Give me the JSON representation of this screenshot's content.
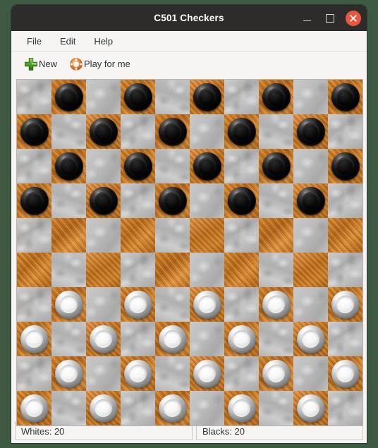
{
  "window": {
    "title": "C501 Checkers",
    "controls": {
      "minimize": "minimize",
      "maximize": "maximize",
      "close": "close"
    },
    "colors": {
      "titlebar_bg": "#2e2c2b",
      "title_fg": "#ffffff",
      "close_bg": "#e9573f",
      "chrome_bg": "#f6f5f4",
      "desktop_bg": "#3e5a42"
    }
  },
  "menubar": {
    "items": [
      {
        "label": "File"
      },
      {
        "label": "Edit"
      },
      {
        "label": "Help"
      }
    ]
  },
  "toolbar": {
    "buttons": [
      {
        "label": "New",
        "icon": "green-plus-icon"
      },
      {
        "label": "Play for me",
        "icon": "lifebuoy-icon"
      }
    ]
  },
  "board": {
    "rows": 10,
    "cols": 10,
    "square_size_px": 49,
    "dark_square_color": "#c97a2a",
    "light_square_color": "#b8b8b8",
    "dark_square_material": "orange wood grain",
    "light_square_material": "brushed grey metal",
    "black_piece_color": "#0a0a0a",
    "white_piece_color": "#e8e8e8",
    "layout": [
      [
        "",
        "b",
        "",
        "b",
        "",
        "b",
        "",
        "b",
        "",
        "b"
      ],
      [
        "b",
        "",
        "b",
        "",
        "b",
        "",
        "b",
        "",
        "b",
        ""
      ],
      [
        "",
        "b",
        "",
        "b",
        "",
        "b",
        "",
        "b",
        "",
        "b"
      ],
      [
        "b",
        "",
        "b",
        "",
        "b",
        "",
        "b",
        "",
        "b",
        ""
      ],
      [
        "",
        "",
        "",
        "",
        "",
        "",
        "",
        "",
        "",
        ""
      ],
      [
        "",
        "",
        "",
        "",
        "",
        "",
        "",
        "",
        "",
        ""
      ],
      [
        "",
        "w",
        "",
        "w",
        "",
        "w",
        "",
        "w",
        "",
        "w"
      ],
      [
        "w",
        "",
        "w",
        "",
        "w",
        "",
        "w",
        "",
        "w",
        ""
      ],
      [
        "",
        "w",
        "",
        "w",
        "",
        "w",
        "",
        "w",
        "",
        "w"
      ],
      [
        "w",
        "",
        "w",
        "",
        "w",
        "",
        "w",
        "",
        "w",
        ""
      ]
    ]
  },
  "statusbar": {
    "whites": "Whites: 20",
    "blacks": "Blacks: 20"
  }
}
